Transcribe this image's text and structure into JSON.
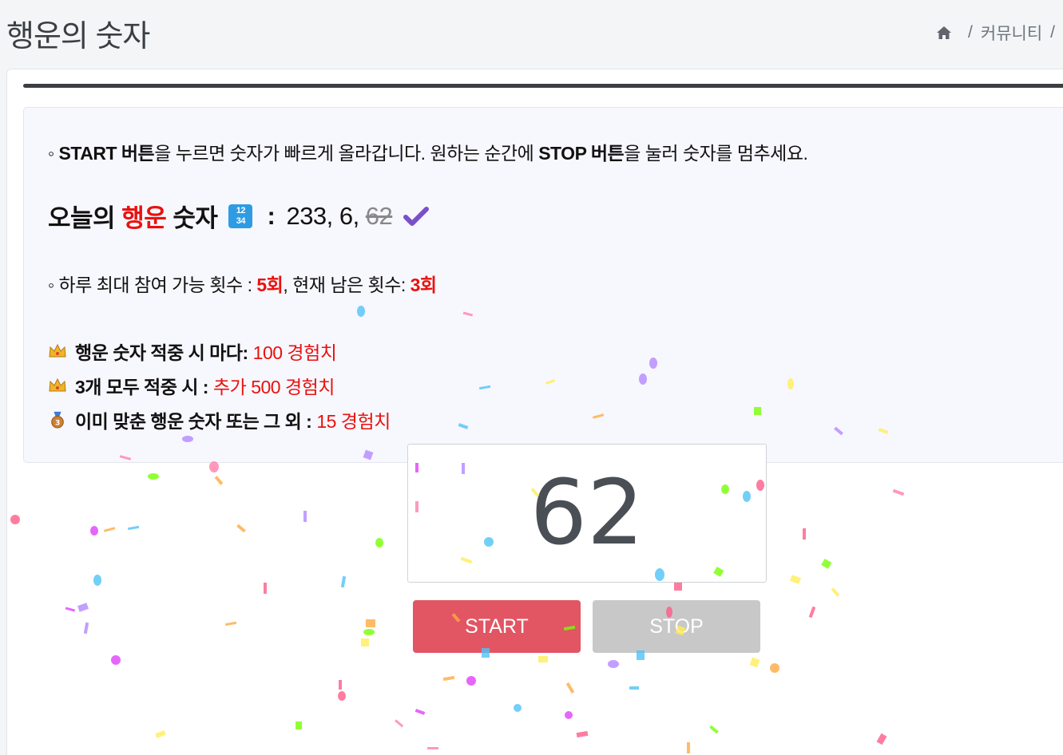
{
  "header": {
    "title": "행운의 숫자",
    "breadcrumb": {
      "home_icon": "home-icon",
      "items": [
        "커뮤니티"
      ],
      "separator": "/"
    }
  },
  "info": {
    "instruction_prefix": "◦ ",
    "instruction_start": "START 버튼",
    "instruction_mid": "을 누르면 숫자가 빠르게 올라갑니다. 원하는 순간에 ",
    "instruction_stop": "STOP 버튼",
    "instruction_end": "을 눌러 숫자를 멈추세요.",
    "today_label_1": "오늘의 ",
    "today_label_red": "행운",
    "today_label_2": " 숫자",
    "today_icon": "1234-icon",
    "today_colon": " : ",
    "today_numbers": "233, 6,",
    "today_struck": "62",
    "check_icon": "check-icon",
    "limit_prefix": "◦ 하루 최대 참여 가능 횟수 : ",
    "limit_max": "5회",
    "limit_mid": ", 현재 남은 횟수: ",
    "limit_remaining": "3회",
    "rewards": [
      {
        "icon": "crown-icon",
        "label": "행운 숫자 적중 시 마다:",
        "value": "100 경험치"
      },
      {
        "icon": "crown-icon",
        "label": "3개 모두 적중 시 :",
        "value": "추가 500 경험치"
      },
      {
        "icon": "bronze-medal-icon",
        "label": "이미 맞춘 행운 숫자 또는 그 외 :",
        "value": "15 경험치"
      }
    ]
  },
  "game": {
    "current_number": "62",
    "start_label": "START",
    "stop_label": "STOP"
  },
  "colors": {
    "accent_red": "#e8120e",
    "start_button": "#e25563",
    "stop_button": "#c8c8c8"
  }
}
